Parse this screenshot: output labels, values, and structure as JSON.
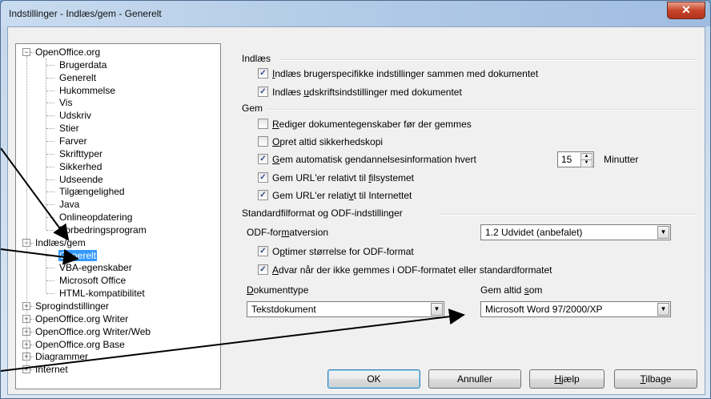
{
  "window": {
    "title": "Indstillinger - Indlæs/gem - Generelt",
    "close_glyph": "✕"
  },
  "tree": {
    "nodes": [
      {
        "label": "OpenOffice.org",
        "toggle": "−"
      },
      {
        "label": "Brugerdata"
      },
      {
        "label": "Generelt"
      },
      {
        "label": "Hukommelse"
      },
      {
        "label": "Vis"
      },
      {
        "label": "Udskriv"
      },
      {
        "label": "Stier"
      },
      {
        "label": "Farver"
      },
      {
        "label": "Skrifttyper"
      },
      {
        "label": "Sikkerhed"
      },
      {
        "label": "Udseende"
      },
      {
        "label": "Tilgængelighed"
      },
      {
        "label": "Java"
      },
      {
        "label": "Onlineopdatering"
      },
      {
        "label": "Forbedringsprogram"
      },
      {
        "label": "Indlæs/gem",
        "toggle": "−"
      },
      {
        "label": "Generelt"
      },
      {
        "label": "VBA-egenskaber"
      },
      {
        "label": "Microsoft Office"
      },
      {
        "label": "HTML-kompatibilitet"
      },
      {
        "label": "Sprogindstillinger",
        "toggle": "+"
      },
      {
        "label": "OpenOffice.org Writer",
        "toggle": "+"
      },
      {
        "label": "OpenOffice.org Writer/Web",
        "toggle": "+"
      },
      {
        "label": "OpenOffice.org Base",
        "toggle": "+"
      },
      {
        "label": "Diagrammer",
        "toggle": "+"
      },
      {
        "label": "Internet",
        "toggle": "+"
      }
    ],
    "selected": "Generelt"
  },
  "load": {
    "heading": "Indlæs",
    "user_settings": {
      "pre": "",
      "key": "I",
      "post": "ndlæs brugerspecifikke indstillinger sammen med dokumentet",
      "checked": true
    },
    "printer_settings": {
      "pre": "Indlæs ",
      "key": "u",
      "post": "dskriftsindstillinger med dokumentet",
      "checked": true
    }
  },
  "save": {
    "heading": "Gem",
    "edit_props": {
      "pre": "",
      "key": "R",
      "post": "ediger dokumentegenskaber før der gemmes",
      "checked": false
    },
    "backup": {
      "pre": "",
      "key": "O",
      "post": "pret altid sikkerhedskopi",
      "checked": false
    },
    "autorecovery": {
      "pre": "",
      "key": "G",
      "post": "em automatisk gendannelsesinformation hvert",
      "checked": true
    },
    "autorecovery_minutes": "15",
    "minutes_label": "Minutter",
    "url_fs": {
      "pre": "Gem URL'er relativt til ",
      "key": "f",
      "post": "ilsystemet",
      "checked": true
    },
    "url_inet": {
      "pre": "Gem URL'er relati",
      "key": "v",
      "post": "t til Internettet",
      "checked": true
    }
  },
  "format": {
    "heading": "Standardfilformat og ODF-indstillinger",
    "odf_label": {
      "pre": "ODF-for",
      "key": "m",
      "post": "atversion"
    },
    "odf_value": "1.2 Udvidet (anbefalet)",
    "optimize": {
      "pre": "O",
      "key": "p",
      "post": "timer størrelse for ODF-format",
      "checked": true
    },
    "warn": {
      "pre": "",
      "key": "A",
      "post": "dvar når der ikke gemmes i ODF-formatet eller standardformatet",
      "checked": true
    },
    "doctype_label": {
      "pre": "",
      "key": "D",
      "post": "okumenttype"
    },
    "doctype_value": "Tekstdokument",
    "save_as_label": {
      "pre": "Gem altid ",
      "key": "s",
      "post": "om"
    },
    "save_as_value": "Microsoft Word 97/2000/XP"
  },
  "buttons": {
    "ok": "OK",
    "cancel": "Annuller",
    "help": {
      "pre": "",
      "key": "H",
      "post": "jælp"
    },
    "back": {
      "pre": "",
      "key": "T",
      "post": "ilbage"
    }
  },
  "check_glyph": "✓",
  "arrow_glyph": "▼"
}
